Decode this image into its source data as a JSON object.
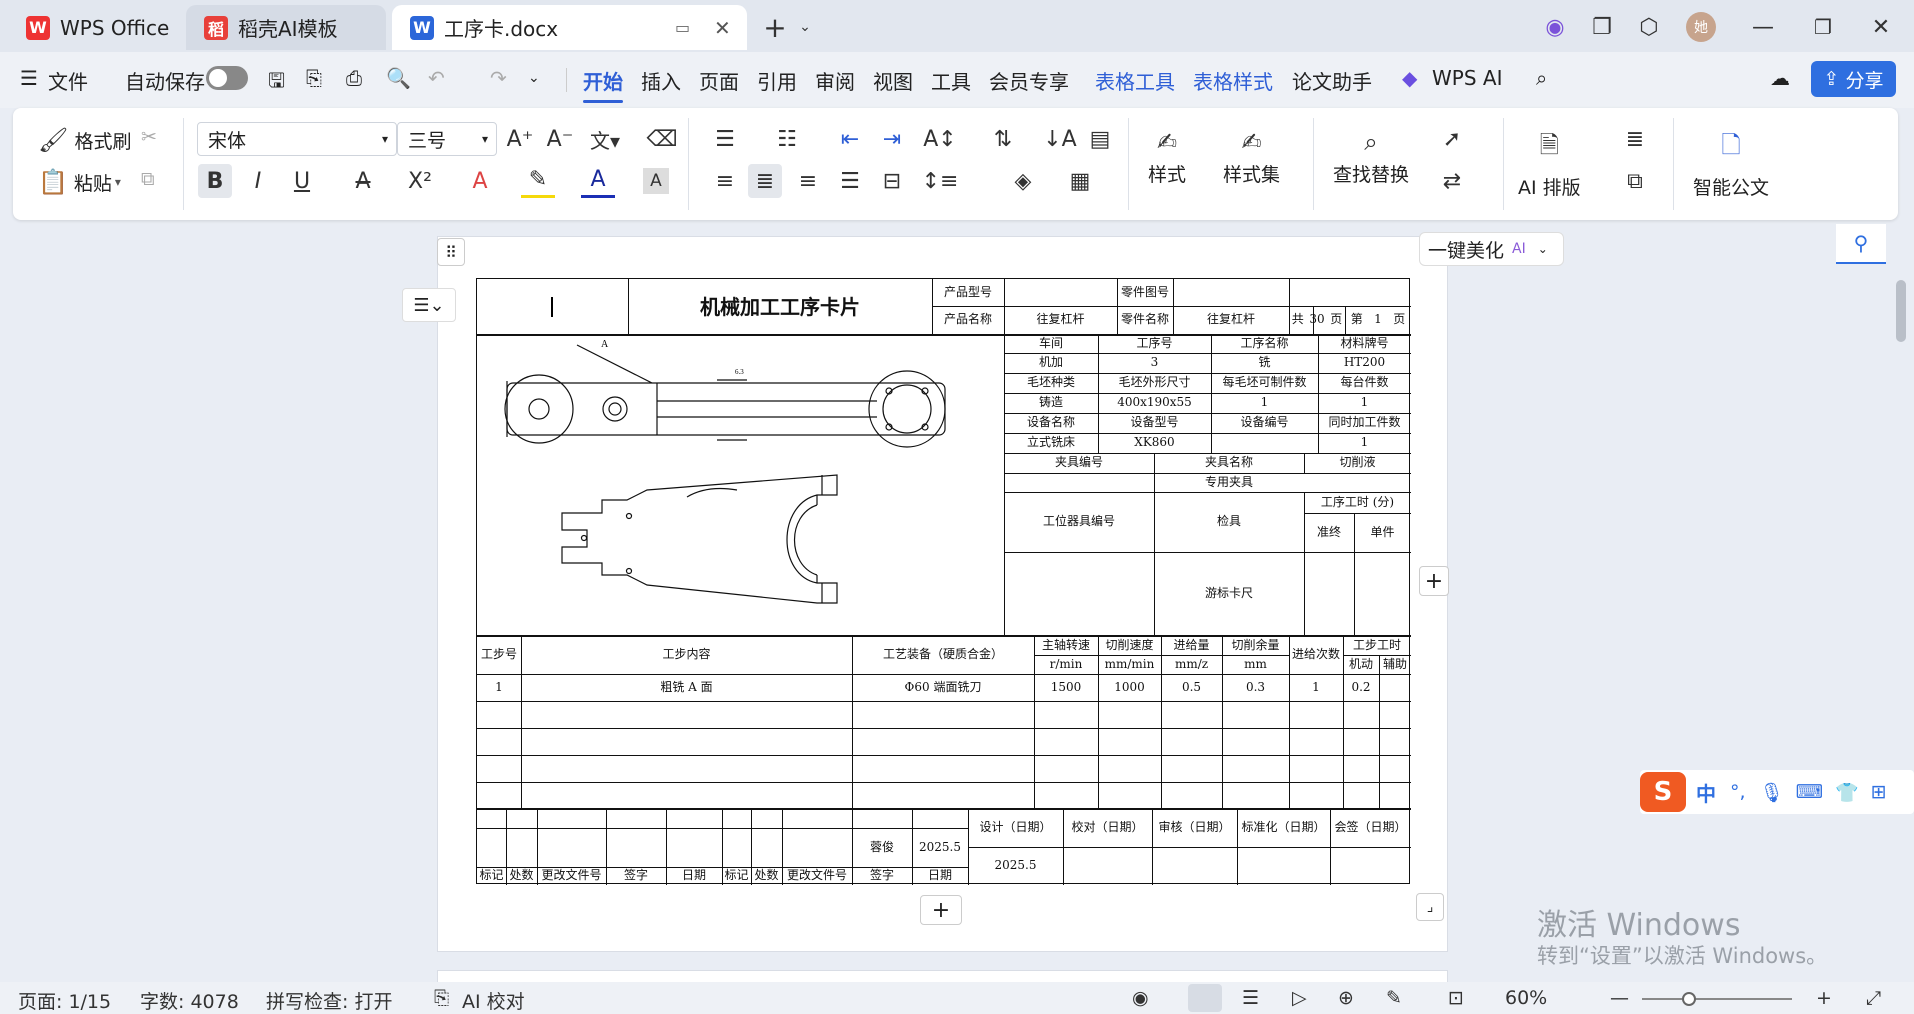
{
  "tabs": [
    {
      "label": "WPS Office",
      "icon": "wps-logo-icon"
    },
    {
      "label": "稻壳AI模板",
      "icon": "docer-icon"
    },
    {
      "label": "工序卡.docx",
      "icon": "word-doc-icon"
    }
  ],
  "menu": {
    "file": "文件",
    "autosave": "自动保存",
    "tabs": [
      "开始",
      "插入",
      "页面",
      "引用",
      "审阅",
      "视图",
      "工具",
      "会员专享",
      "表格工具",
      "表格样式",
      "论文助手"
    ],
    "wps_ai": "WPS AI",
    "share": "分享"
  },
  "ribbon": {
    "format_painter": "格式刷",
    "paste": "粘贴",
    "font_name": "宋体",
    "font_size": "三号",
    "styles": "样式",
    "style_set": "样式集",
    "find_replace": "查找替换",
    "ai_layout": "AI 排版",
    "smart_doc": "智能公文"
  },
  "beautify": {
    "label": "一键美化",
    "ai": "AI"
  },
  "card": {
    "title": "机械加工工序卡片",
    "product_model_label": "产品型号",
    "part_drawing_label": "零件图号",
    "product_name_label": "产品名称",
    "product_name": "往复杠杆",
    "part_name_label": "零件名称",
    "part_name": "往复杠杆",
    "total_label": "共",
    "total": "30",
    "page_unit": "页",
    "page_label": "第",
    "page": "1",
    "page_unit2": "页",
    "info": [
      [
        "车间",
        "工序号",
        "工序名称",
        "材料牌号"
      ],
      [
        "机加",
        "3",
        "铣",
        "HT200"
      ],
      [
        "毛坯种类",
        "毛坯外形尺寸",
        "每毛坯可制件数",
        "每台件数"
      ],
      [
        "铸造",
        "400x190x55",
        "1",
        "1"
      ],
      [
        "设备名称",
        "设备型号",
        "设备编号",
        "同时加工件数"
      ],
      [
        "立式铣床",
        "XK860",
        "",
        "1"
      ]
    ],
    "fixture_no": "夹具编号",
    "fixture_name": "夹具名称",
    "coolant": "切削液",
    "special_fixture": "专用夹具",
    "station_tool_no": "工位器具编号",
    "station_tool_name": "检具",
    "process_time": "工序工时 (分)",
    "prep_end": "准终",
    "unit": "单件",
    "caliper": "游标卡尺",
    "steps_header": {
      "step_no": "工步号",
      "step_content": "工步内容",
      "equipment": "工艺装备（硬质合金）",
      "spindle_speed": "主轴转速",
      "spindle_unit": "r/min",
      "cutting_speed": "切削速度",
      "cutting_unit": "mm/min",
      "feed": "进给量",
      "feed_unit": "mm/z",
      "depth": "切削余量",
      "depth_unit": "mm",
      "passes": "进给次数",
      "step_time": "工步工时",
      "machine": "机动",
      "aux": "辅助"
    },
    "step1": {
      "no": "1",
      "content": "粗铣 A 面",
      "tool": "Φ60 端面铣刀",
      "speed": "1500",
      "cut": "1000",
      "feed": "0.5",
      "depth": "0.3",
      "passes": "1",
      "time": "0.2"
    },
    "footer": {
      "compiled": "蓉俊",
      "date1": "2025.5",
      "design": "设计（日期）",
      "check": "校对（日期）",
      "review": "审核（日期）",
      "standard": "标准化（日期）",
      "countersign": "会签（日期）",
      "design_date": "2025.5",
      "cols": [
        "标记",
        "处数",
        "更改文件号",
        "签字",
        "日期",
        "标记",
        "处数",
        "更改文件号",
        "签字",
        "日期"
      ]
    },
    "drawing_label_a": "A",
    "drawing_label_roughness": "6.3"
  },
  "status": {
    "page": "页面: 1/15",
    "words": "字数: 4078",
    "spell": "拼写检查: 打开",
    "ai_check": "AI 校对",
    "zoom": "60%"
  },
  "watermark": {
    "line1": "激活 Windows",
    "line2": "转到“设置”以激活 Windows。"
  },
  "ime": {
    "lang": "中"
  }
}
